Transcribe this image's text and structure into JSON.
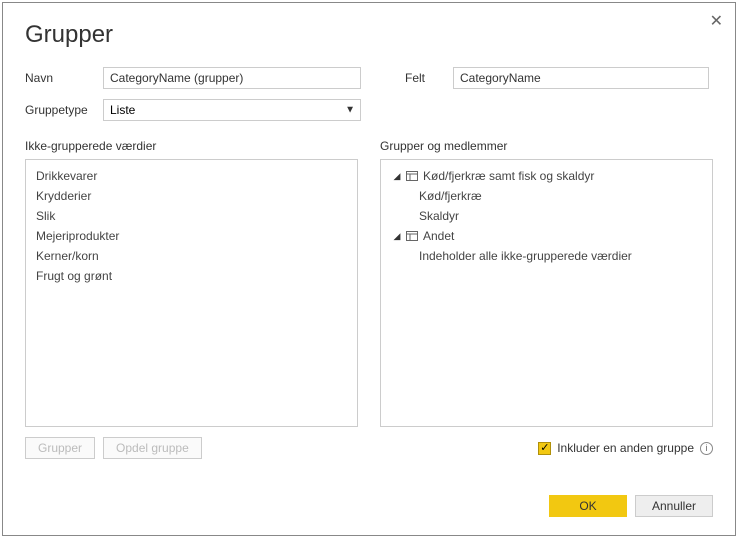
{
  "dialog": {
    "title": "Grupper"
  },
  "form": {
    "name_label": "Navn",
    "name_value": "CategoryName (grupper)",
    "field_label": "Felt",
    "field_value": "CategoryName",
    "grouptype_label": "Gruppetype",
    "grouptype_value": "Liste"
  },
  "left": {
    "header": "Ikke-grupperede værdier",
    "items": [
      "Drikkevarer",
      "Krydderier",
      "Slik",
      "Mejeriprodukter",
      "Kerner/korn",
      "Frugt og grønt"
    ]
  },
  "right": {
    "header": "Grupper og medlemmer",
    "groups": [
      {
        "name": "Kød/fjerkræ samt fisk og skaldyr",
        "children": [
          "Kød/fjerkræ",
          "Skaldyr"
        ]
      },
      {
        "name": "Andet",
        "children": [
          "Indeholder alle ikke-grupperede værdier"
        ]
      }
    ]
  },
  "buttons": {
    "group": "Grupper",
    "ungroup": "Opdel gruppe",
    "ok": "OK",
    "cancel": "Annuller"
  },
  "include": {
    "label": "Inkluder en anden gruppe",
    "checked": true
  }
}
